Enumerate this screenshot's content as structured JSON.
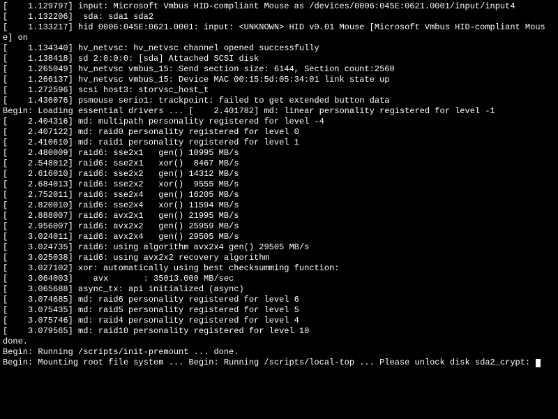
{
  "console": {
    "lines": [
      "[    1.129797] input: Microsoft Vmbus HID-compliant Mouse as /devices/0006:045E:0621.0001/input/input4",
      "[    1.132206]  sda: sda1 sda2",
      "[    1.133217] hid 0006:045E:0621.0001: input: <UNKNOWN> HID v0.01 Mouse [Microsoft Vmbus HID-compliant Mouse] on ",
      "[    1.134340] hv_netvsc: hv_netvsc channel opened successfully",
      "[    1.138418] sd 2:0:0:0: [sda] Attached SCSI disk",
      "[    1.265049] hv_netvsc vmbus_15: Send section size: 6144, Section count:2560",
      "[    1.266137] hv_netvsc vmbus_15: Device MAC 00:15:5d:05:34:01 link state up",
      "[    1.272596] scsi host3: storvsc_host_t",
      "[    1.436076] psmouse serio1: trackpoint: failed to get extended button data",
      "Begin: Loading essential drivers ... [    2.401782] md: linear personality registered for level -1",
      "[    2.404316] md: multipath personality registered for level -4",
      "[    2.407122] md: raid0 personality registered for level 0",
      "[    2.410610] md: raid1 personality registered for level 1",
      "[    2.480009] raid6: sse2x1   gen() 10995 MB/s",
      "[    2.548012] raid6: sse2x1   xor()  8467 MB/s",
      "[    2.616010] raid6: sse2x2   gen() 14312 MB/s",
      "[    2.684013] raid6: sse2x2   xor()  9555 MB/s",
      "[    2.752011] raid6: sse2x4   gen() 16205 MB/s",
      "[    2.820010] raid6: sse2x4   xor() 11594 MB/s",
      "[    2.888007] raid6: avx2x1   gen() 21995 MB/s",
      "[    2.956007] raid6: avx2x2   gen() 25959 MB/s",
      "[    3.024011] raid6: avx2x4   gen() 29505 MB/s",
      "[    3.024735] raid6: using algorithm avx2x4 gen() 29505 MB/s",
      "[    3.025038] raid6: using avx2x2 recovery algorithm",
      "[    3.027102] xor: automatically using best checksumming function:",
      "[    3.064003]    avx       : 35013.000 MB/sec",
      "[    3.065688] async_tx: api initialized (async)",
      "[    3.074685] md: raid6 personality registered for level 6",
      "[    3.075435] md: raid5 personality registered for level 5",
      "[    3.075746] md: raid4 personality registered for level 4",
      "[    3.079565] md: raid10 personality registered for level 10",
      "done.",
      "Begin: Running /scripts/init-premount ... done.",
      "Begin: Mounting root file system ... Begin: Running /scripts/local-top ... Please unlock disk sda2_crypt: "
    ]
  }
}
